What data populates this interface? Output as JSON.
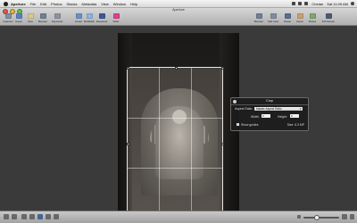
{
  "menubar": {
    "app_name": "Aperture",
    "menus": [
      "File",
      "Edit",
      "Photos",
      "Stacks",
      "Metadata",
      "View",
      "Window",
      "Help"
    ],
    "status": {
      "user": "Chetan",
      "clock": "Sat 11:09 AM"
    }
  },
  "window": {
    "title": "Aperture"
  },
  "toolbar": {
    "left": [
      {
        "label": "Inspector",
        "color": "#7e8fa8",
        "icon": "inspector-icon"
      },
      {
        "label": "Import",
        "color": "#5a7fbd",
        "icon": "import-icon"
      },
      {
        "label": "New",
        "color": "#d8c890",
        "icon": "new-icon"
      },
      {
        "label": "Browser",
        "color": "#6e7f96",
        "icon": "browser-icon"
      },
      {
        "label": "Keywords",
        "color": "#8b93a3",
        "icon": "keywords-icon"
      },
      {
        "label": "Email",
        "color": "#6a8fc8",
        "icon": "email-icon"
      },
      {
        "label": "MobileMe",
        "color": "#8db3e0",
        "icon": "mobileme-icon"
      },
      {
        "label": "Facebook",
        "color": "#3b5998",
        "icon": "facebook-icon"
      },
      {
        "label": "Flickr",
        "color": "#e0408f",
        "icon": "flickr-icon"
      }
    ],
    "right": [
      {
        "label": "Browser",
        "color": "#6e7f96",
        "icon": "browser-icon"
      },
      {
        "label": "Split View",
        "color": "#7f8da3",
        "icon": "split-view-icon"
      },
      {
        "label": "Viewer",
        "color": "#5b6e8c",
        "icon": "viewer-icon"
      },
      {
        "label": "Faces",
        "color": "#c9a070",
        "icon": "faces-icon"
      },
      {
        "label": "Places",
        "color": "#7aa86a",
        "icon": "places-icon"
      },
      {
        "label": "Full Screen",
        "color": "#4b5b75",
        "icon": "full-screen-icon"
      }
    ]
  },
  "crop_hud": {
    "title": "Crop",
    "aspect_ratio_label": "Aspect Ratio:",
    "aspect_ratio_value": "Master Aspect Ratio",
    "width_label": "Width:",
    "width_value": "0",
    "height_label": "Height:",
    "height_value": "0",
    "show_guides_label": "Show guides",
    "show_guides_checked": true,
    "size_text": "Size: 6.3 MP"
  }
}
